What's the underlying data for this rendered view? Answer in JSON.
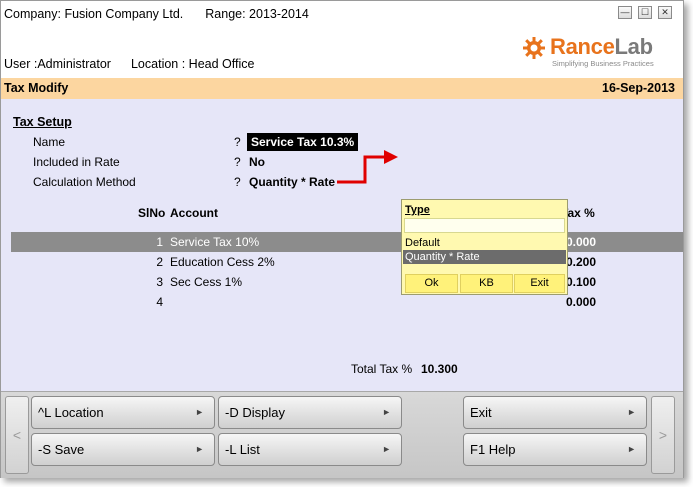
{
  "header": {
    "company": "Company: Fusion Company Ltd.",
    "range": "Range: 2013-2014",
    "user": "User :Administrator",
    "location": "Location : Head Office"
  },
  "window_controls": {
    "minimize": "—",
    "maximize": "☐",
    "close": "✕"
  },
  "logo": {
    "part1": "Rance",
    "part2": "Lab",
    "tagline": "Simplifying Business Practices",
    "colors": {
      "rance": "#e8731c",
      "lab": "#7a7a7a"
    }
  },
  "title_bar": {
    "title": "Tax Modify",
    "date": "16-Sep-2013",
    "color": "#fcd6a0"
  },
  "form": {
    "section_title": "Tax Setup",
    "fields": [
      {
        "label": "Name",
        "sep": "?",
        "value": "Service Tax 10.3%"
      },
      {
        "label": "Included in Rate",
        "sep": "?",
        "value": "No"
      },
      {
        "label": "Calculation Method",
        "sep": "?",
        "value": "Quantity * Rate"
      }
    ]
  },
  "table": {
    "headers": {
      "sino": "SlNo",
      "account": "Account",
      "tax": "Tax %"
    },
    "rows": [
      {
        "sino": "1",
        "account": "Service Tax 10%",
        "tax": "10.000",
        "selected": true
      },
      {
        "sino": "2",
        "account": "Education Cess 2%",
        "tax": "0.200"
      },
      {
        "sino": "3",
        "account": "Sec Cess 1%",
        "tax": "0.100"
      },
      {
        "sino": "4",
        "account": "",
        "tax": "0.000"
      }
    ],
    "total_label": "Total Tax %",
    "total_value": "10.300"
  },
  "type_popup": {
    "title": "Type",
    "input_value": "",
    "options": [
      "Default",
      "Quantity * Rate"
    ],
    "selected_option": "Quantity * Rate",
    "buttons": {
      "ok": "Ok",
      "kb": "KB",
      "exit": "Exit"
    }
  },
  "annotation_arrow": {
    "color": "#e00000"
  },
  "footer": {
    "buttons": [
      {
        "label": "^L Location"
      },
      {
        "label": "-D Display"
      },
      {
        "label": "Exit"
      },
      {
        "label": "-S Save"
      },
      {
        "label": "-L List"
      },
      {
        "label": "F1 Help"
      }
    ],
    "prev": "<",
    "next": ">"
  }
}
